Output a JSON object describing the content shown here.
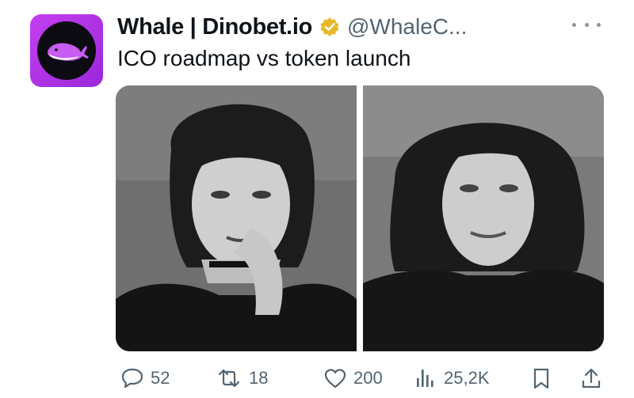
{
  "author": {
    "display_name": "Whale | Dinobet.io",
    "handle": "@WhaleC...",
    "avatar_icon": "whale-logo-icon",
    "verified_icon": "verified-badge-icon",
    "verified_color": "#e8b82a",
    "avatar_color": "#b933e8"
  },
  "tweet": {
    "text": "ICO roadmap vs token launch"
  },
  "media": {
    "icons": [
      "photo-left",
      "photo-right"
    ]
  },
  "actions": {
    "reply_count": "52",
    "retweet_count": "18",
    "like_count": "200",
    "views_count": "25,2K"
  },
  "colors": {
    "text": "#0f1419",
    "muted": "#536471"
  }
}
